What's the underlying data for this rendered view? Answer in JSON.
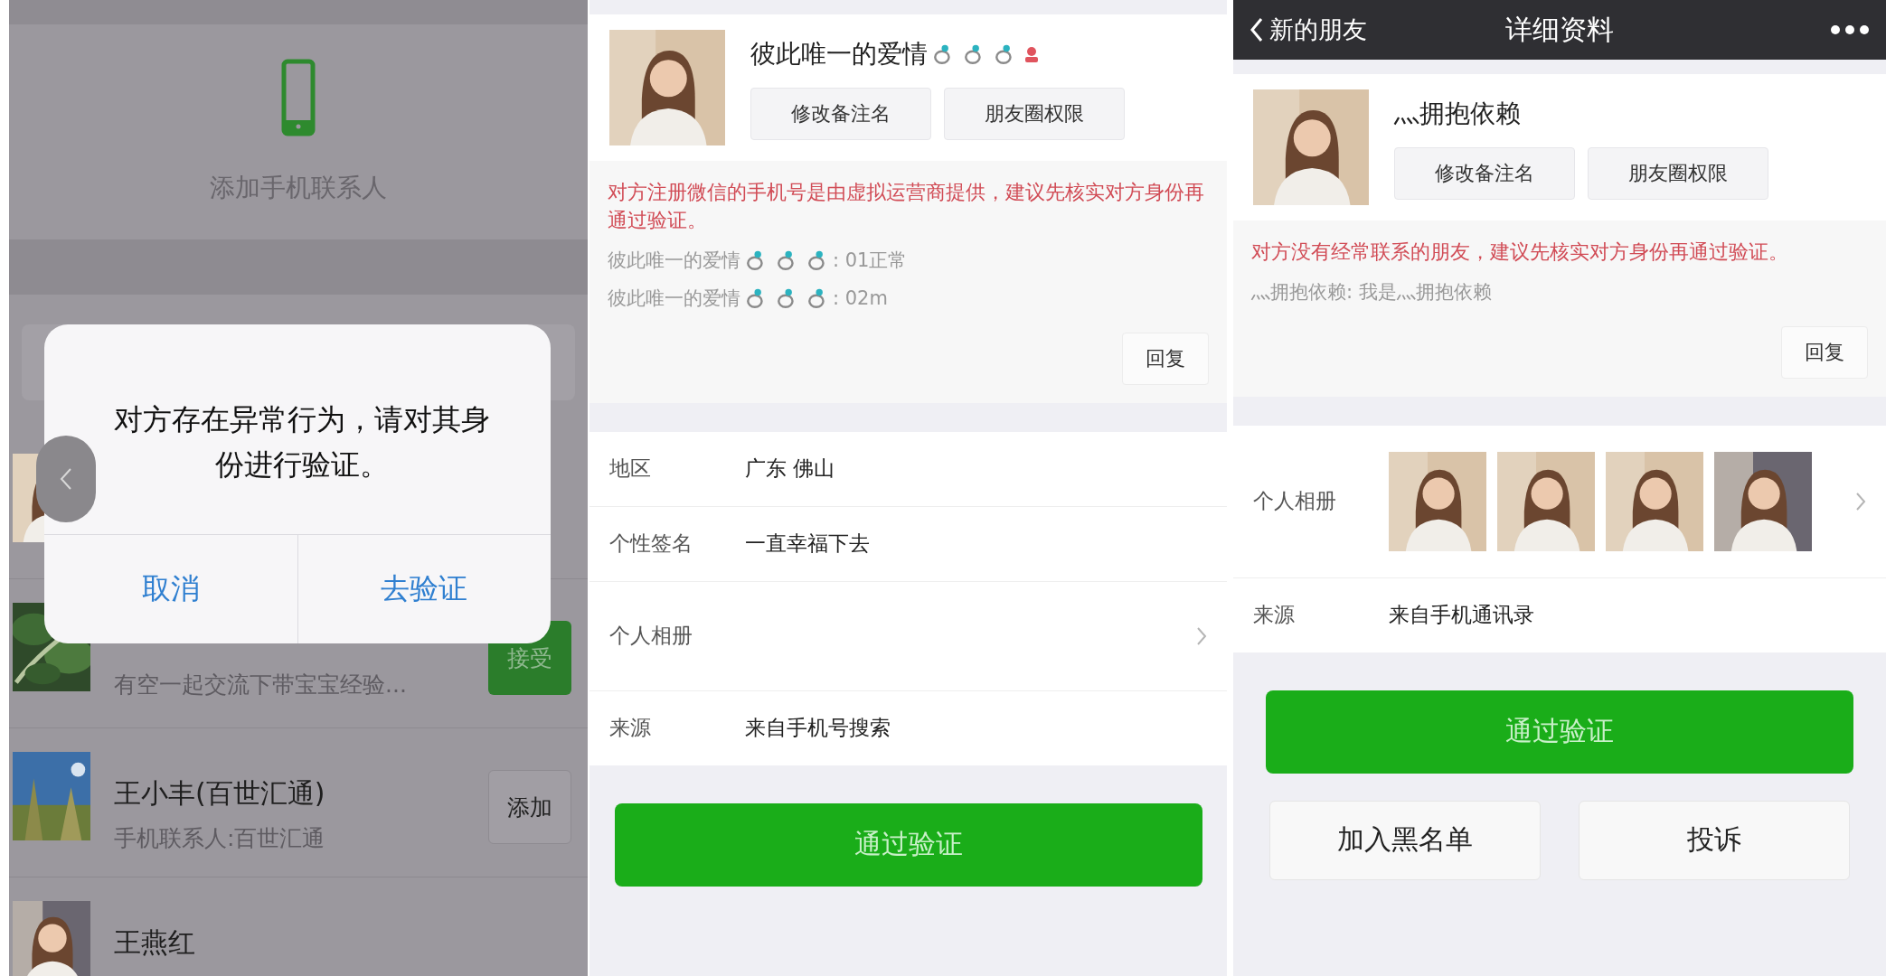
{
  "new_friends_screen": {
    "add_phone_contacts": {
      "label": "添加手机联系人"
    },
    "requests": [
      {
        "avatar": {
          "kind": "picture"
        }
      },
      {
        "avatar": {
          "kind": "picture"
        },
        "subtitle": "有空一起交流下带宝宝经验...",
        "action": {
          "label": "接受",
          "kind": "accept"
        }
      },
      {
        "avatar": {
          "kind": "picture"
        },
        "name": "王小丰(百世汇通)",
        "subtitle": "手机联系人:百世汇通",
        "action": {
          "label": "添加",
          "kind": "add"
        }
      },
      {
        "avatar": {
          "kind": "picture"
        },
        "name": "王燕红"
      }
    ],
    "dialog": {
      "message": "对方存在异常行为，请对其身份进行验证。",
      "buttons": [
        {
          "label": "取消"
        },
        {
          "label": "去验证"
        }
      ]
    }
  },
  "profile_screen_a": {
    "name": "彼此唯一的爱情",
    "buttons": [
      {
        "label": "修改备注名"
      },
      {
        "label": "朋友圈权限"
      }
    ],
    "warning": "对方注册微信的手机号是由虚拟运营商提供，建议先核实对方身份再通过验证。",
    "messages": [
      {
        "kind": "rings",
        "sender": "彼此唯一的爱情",
        "text": ": 01正常"
      },
      {
        "kind": "rings",
        "sender": "彼此唯一的爱情",
        "text": ": 02m"
      }
    ],
    "reply_button": "回复",
    "details": [
      {
        "kind": "text",
        "label": "地区",
        "value": "广东 佛山"
      },
      {
        "kind": "text",
        "label": "个性签名",
        "value": "一直幸福下去"
      },
      {
        "kind": "album",
        "label": "个人相册"
      },
      {
        "kind": "text",
        "label": "来源",
        "value": "来自手机号搜索"
      }
    ],
    "primary_button": "通过验证"
  },
  "profile_screen_b": {
    "header": {
      "back": "新的朋友",
      "title": "详细资料"
    },
    "name": "灬拥抱依赖",
    "buttons": [
      {
        "label": "修改备注名"
      },
      {
        "label": "朋友圈权限"
      }
    ],
    "warning": "对方没有经常联系的朋友，建议先核实对方身份再通过验证。",
    "messages": [
      {
        "kind": "plain",
        "text": "灬拥抱依赖: 我是灬拥抱依赖"
      }
    ],
    "reply_button": "回复",
    "details": [
      {
        "kind": "album",
        "label": "个人相册",
        "photos": [
          {
            "kind": "picture"
          },
          {
            "kind": "picture"
          },
          {
            "kind": "picture"
          },
          {
            "kind": "picture"
          }
        ]
      },
      {
        "kind": "text",
        "label": "来源",
        "value": "来自手机通讯录"
      }
    ],
    "primary_button": "通过验证",
    "secondary_buttons": [
      {
        "label": "加入黑名单"
      },
      {
        "label": "投诉"
      }
    ]
  }
}
